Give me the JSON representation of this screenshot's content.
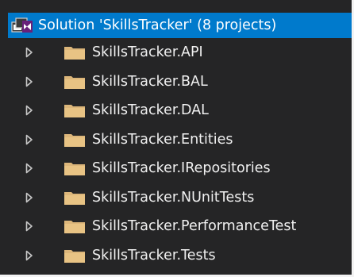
{
  "explorer": {
    "solution": {
      "label": "Solution 'SkillsTracker' (8 projects)",
      "icon": "visual-studio-solution-icon",
      "selected": true
    },
    "projects": [
      {
        "label": "SkillsTracker.API",
        "icon": "folder-icon",
        "expanded": false
      },
      {
        "label": "SkillsTracker.BAL",
        "icon": "folder-icon",
        "expanded": false
      },
      {
        "label": "SkillsTracker.DAL",
        "icon": "folder-icon",
        "expanded": false
      },
      {
        "label": "SkillsTracker.Entities",
        "icon": "folder-icon",
        "expanded": false
      },
      {
        "label": "SkillsTracker.IRepositories",
        "icon": "folder-icon",
        "expanded": false
      },
      {
        "label": "SkillsTracker.NUnitTests",
        "icon": "folder-icon",
        "expanded": false
      },
      {
        "label": "SkillsTracker.PerformanceTest",
        "icon": "folder-icon",
        "expanded": false
      },
      {
        "label": "SkillsTracker.Tests",
        "icon": "folder-icon",
        "expanded": false
      }
    ]
  },
  "colors": {
    "background": "#252526",
    "selection": "#007acc",
    "folder": "#dcb67a",
    "arrow": "#c8c8c8",
    "vs_purple": "#68217a"
  }
}
